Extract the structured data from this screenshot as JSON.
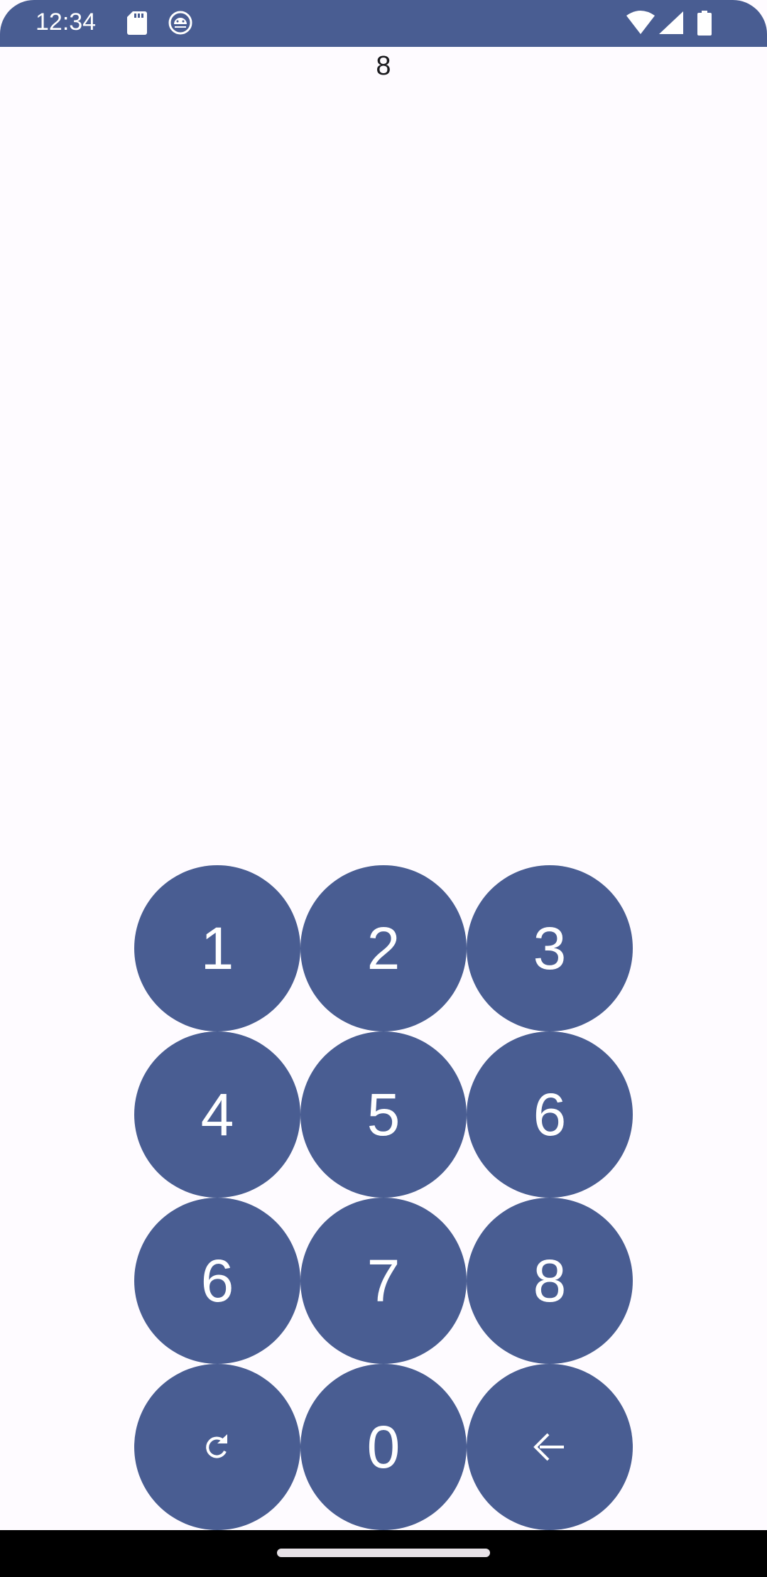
{
  "status_bar": {
    "time": "12:34",
    "background_color": "#495d92",
    "left_icons": [
      "sd-card-icon",
      "android-debug-icon"
    ],
    "right_icons": [
      "wifi-icon",
      "cellular-signal-icon",
      "battery-icon"
    ]
  },
  "display": {
    "value": "8"
  },
  "keypad": {
    "key_color": "#495d92",
    "keys": [
      {
        "label": "1"
      },
      {
        "label": "2"
      },
      {
        "label": "3"
      },
      {
        "label": "4"
      },
      {
        "label": "5"
      },
      {
        "label": "6"
      },
      {
        "label": "6"
      },
      {
        "label": "7"
      },
      {
        "label": "8"
      },
      {
        "icon": "reset-icon"
      },
      {
        "label": "0"
      },
      {
        "icon": "backspace-icon"
      }
    ]
  },
  "nav_bar": {
    "handle": "home-handle"
  }
}
